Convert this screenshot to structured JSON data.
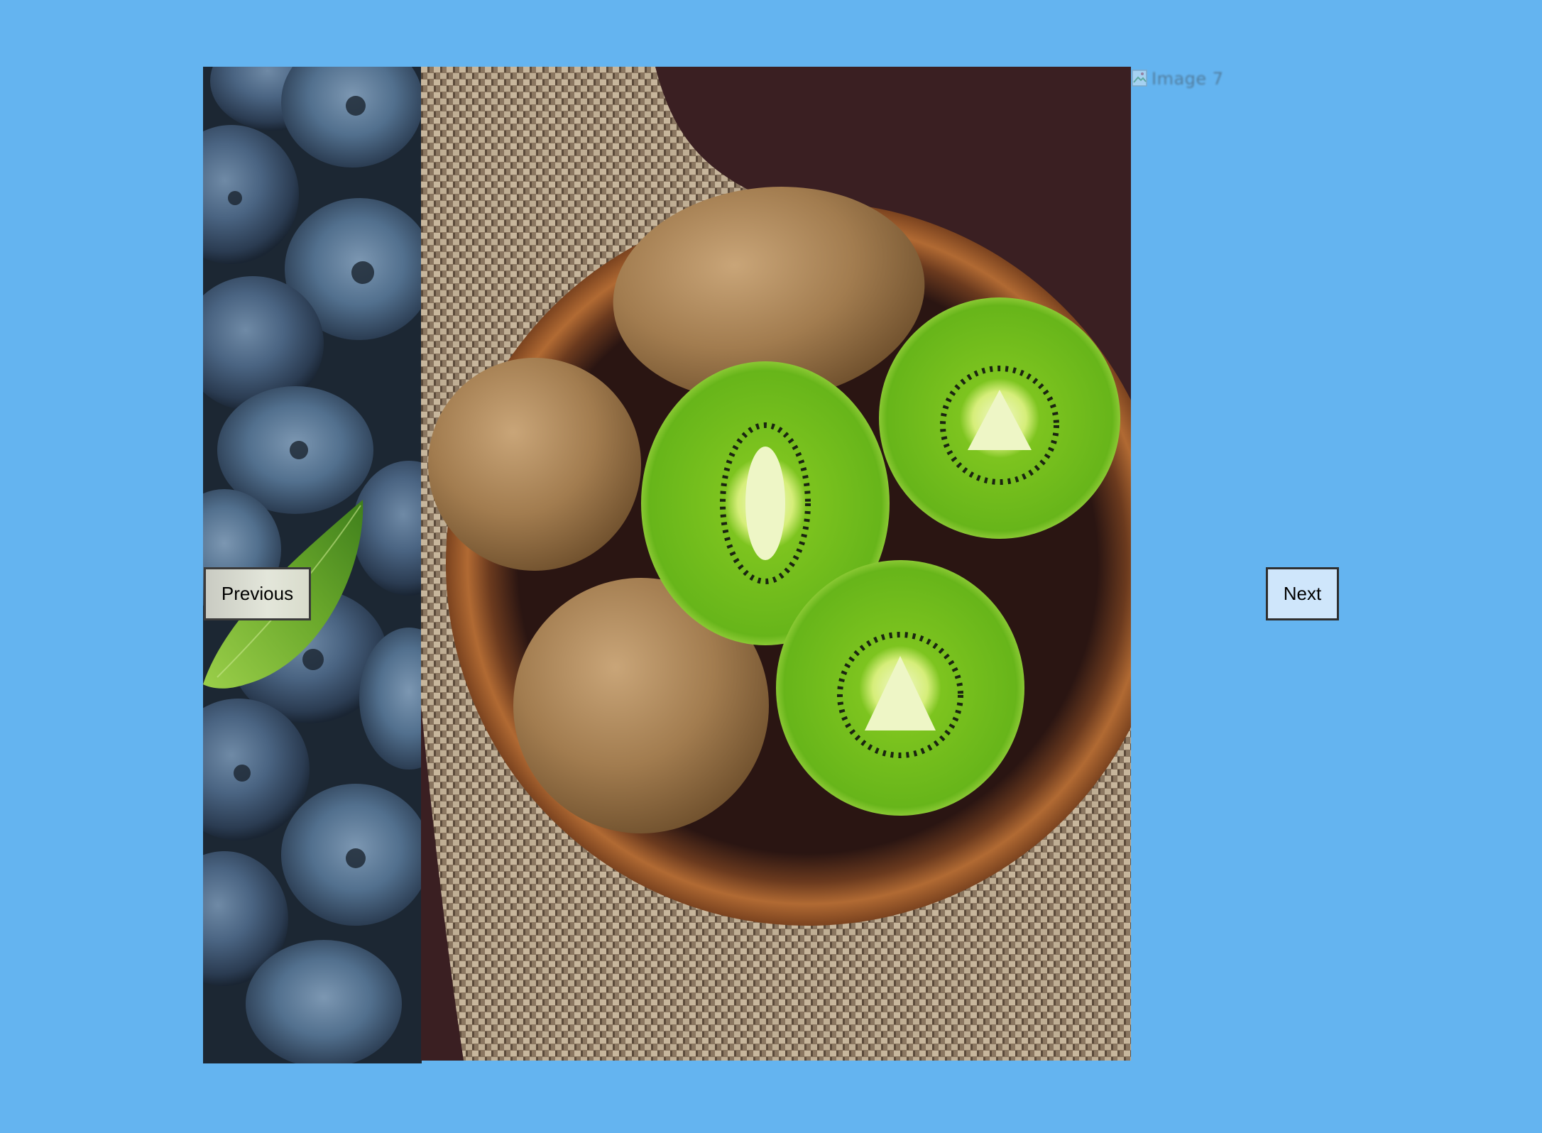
{
  "carousel": {
    "slides": [
      {
        "subject": "blueberries"
      },
      {
        "subject": "kiwi"
      }
    ],
    "broken_image": {
      "alt": "Image 7"
    },
    "prev_label": "Previous",
    "next_label": "Next"
  },
  "colors": {
    "background": "#64b4f0",
    "next_button": "#cfe6fb",
    "prev_button": "#dfe2d6"
  },
  "icons": [
    "broken-image-icon"
  ]
}
